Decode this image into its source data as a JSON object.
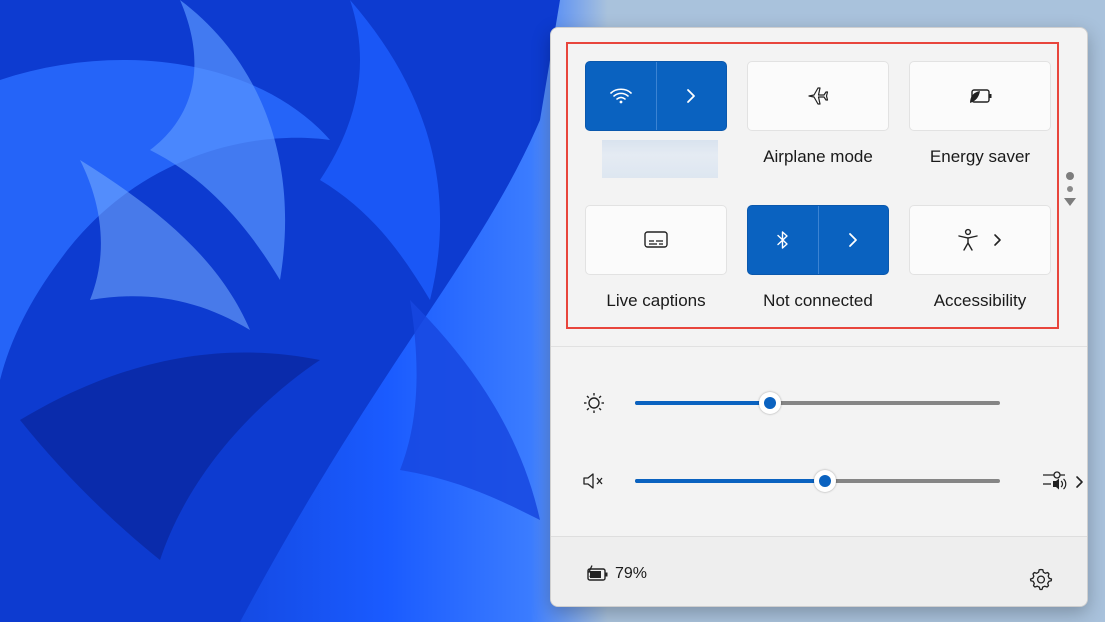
{
  "quick_settings": {
    "tiles": [
      {
        "id": "wifi",
        "label": "",
        "state": "on",
        "icon": "wifi-icon",
        "has_chevron": true
      },
      {
        "id": "airplane",
        "label": "Airplane mode",
        "state": "off",
        "icon": "airplane-icon"
      },
      {
        "id": "energy",
        "label": "Energy saver",
        "state": "off",
        "icon": "energy-saver-icon"
      },
      {
        "id": "captions",
        "label": "Live captions",
        "state": "off",
        "icon": "captions-icon"
      },
      {
        "id": "bluetooth",
        "label": "Not connected",
        "state": "on",
        "icon": "bluetooth-icon",
        "has_chevron": true
      },
      {
        "id": "accessibility",
        "label": "Accessibility",
        "state": "off",
        "icon": "accessibility-icon",
        "has_chevron": true
      }
    ],
    "brightness": {
      "icon": "brightness-icon",
      "level_percent": 37
    },
    "volume": {
      "icon": "volume-muted-icon",
      "level_percent": 52,
      "output_icon": "audio-output-icon"
    },
    "footer": {
      "battery_icon": "battery-charging-icon",
      "battery_text": "79%",
      "settings_icon": "gear-icon"
    }
  },
  "colors": {
    "accent": "#0a62c0",
    "highlight_border": "#e8453c",
    "panel": "#f3f3f3"
  }
}
